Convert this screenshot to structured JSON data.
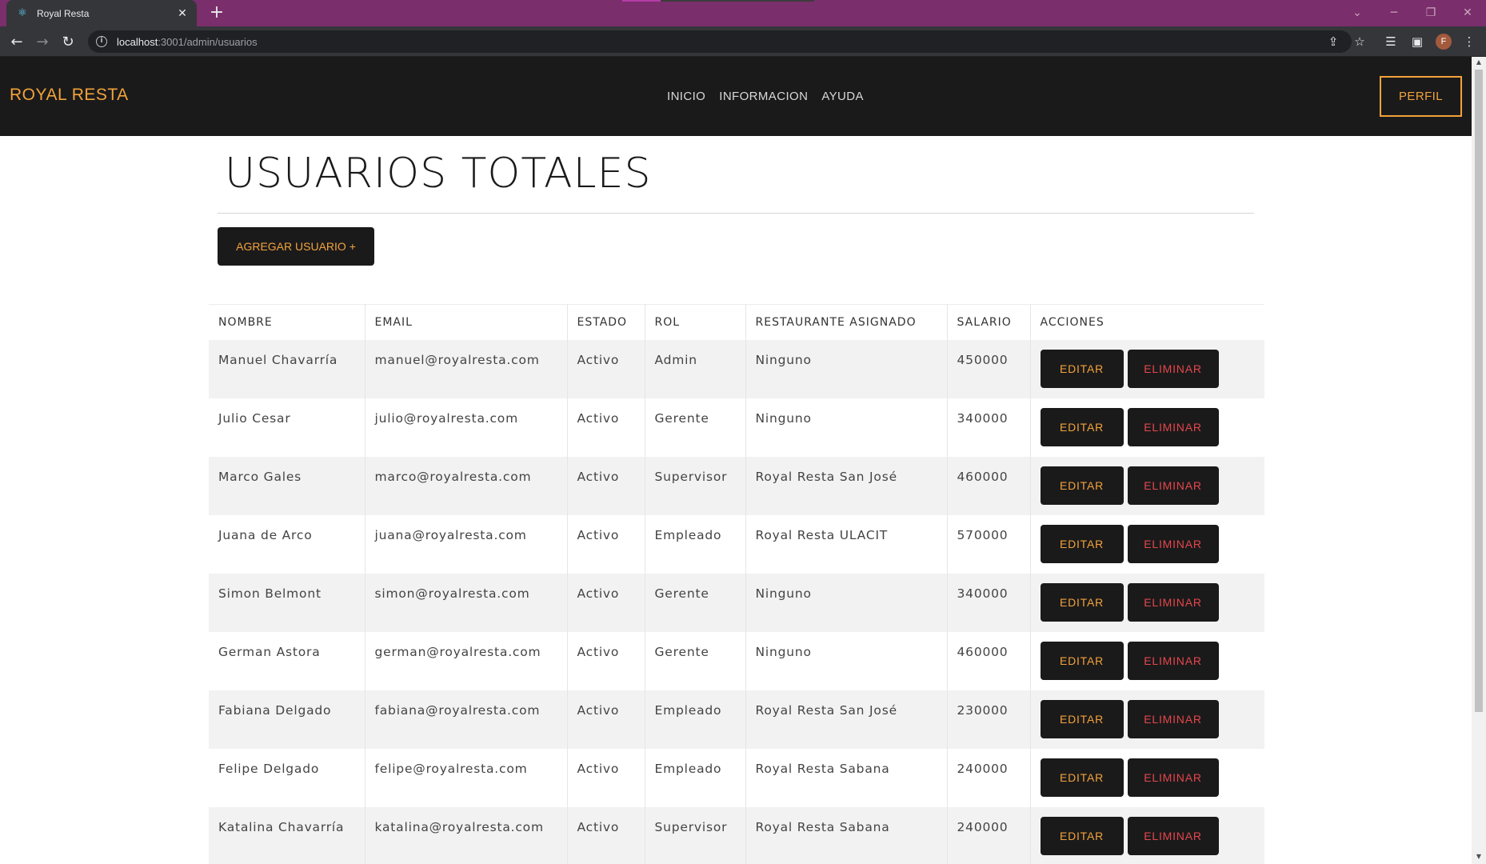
{
  "browser": {
    "tab_title": "Royal Resta",
    "tab_close": "✕",
    "new_tab": "+",
    "url_host": "localhost",
    "url_path": ":3001/admin/usuarios",
    "profile_initial": "F",
    "icons": {
      "favicon": "react-icon",
      "back": "arrow-left-icon",
      "forward": "arrow-right-icon",
      "reload": "reload-icon",
      "info": "info-icon",
      "share": "share-icon",
      "bookmark": "star-icon",
      "reading_list": "reading-list-icon",
      "side_panel": "side-panel-icon",
      "menu": "kebab-menu-icon"
    }
  },
  "site": {
    "brand": "ROYAL RESTA",
    "nav": [
      "INICIO",
      "INFORMACION",
      "AYUDA"
    ],
    "profile_button": "PERFIL",
    "accent_color": "#f2a33b",
    "danger_color": "#e5474b",
    "header_bg": "#1b1a1b"
  },
  "page": {
    "title": "USUARIOS TOTALES",
    "add_button": "AGREGAR USUARIO +"
  },
  "table": {
    "columns": [
      "NOMBRE",
      "EMAIL",
      "ESTADO",
      "ROL",
      "RESTAURANTE ASIGNADO",
      "SALARIO",
      "ACCIONES"
    ],
    "edit_label": "EDITAR",
    "delete_label": "ELIMINAR",
    "rows": [
      [
        "Manuel Chavarría",
        "manuel@royalresta.com",
        "Activo",
        "Admin",
        "Ninguno",
        "450000"
      ],
      [
        "Julio Cesar",
        "julio@royalresta.com",
        "Activo",
        "Gerente",
        "Ninguno",
        "340000"
      ],
      [
        "Marco Gales",
        "marco@royalresta.com",
        "Activo",
        "Supervisor",
        "Royal Resta San José",
        "460000"
      ],
      [
        "Juana de Arco",
        "juana@royalresta.com",
        "Activo",
        "Empleado",
        "Royal Resta ULACIT",
        "570000"
      ],
      [
        "Simon Belmont",
        "simon@royalresta.com",
        "Activo",
        "Gerente",
        "Ninguno",
        "340000"
      ],
      [
        "German Astora",
        "german@royalresta.com",
        "Activo",
        "Gerente",
        "Ninguno",
        "460000"
      ],
      [
        "Fabiana Delgado",
        "fabiana@royalresta.com",
        "Activo",
        "Empleado",
        "Royal Resta San José",
        "230000"
      ],
      [
        "Felipe Delgado",
        "felipe@royalresta.com",
        "Activo",
        "Empleado",
        "Royal Resta Sabana",
        "240000"
      ],
      [
        "Katalina Chavarría",
        "katalina@royalresta.com",
        "Activo",
        "Supervisor",
        "Royal Resta Sabana",
        "240000"
      ]
    ]
  }
}
